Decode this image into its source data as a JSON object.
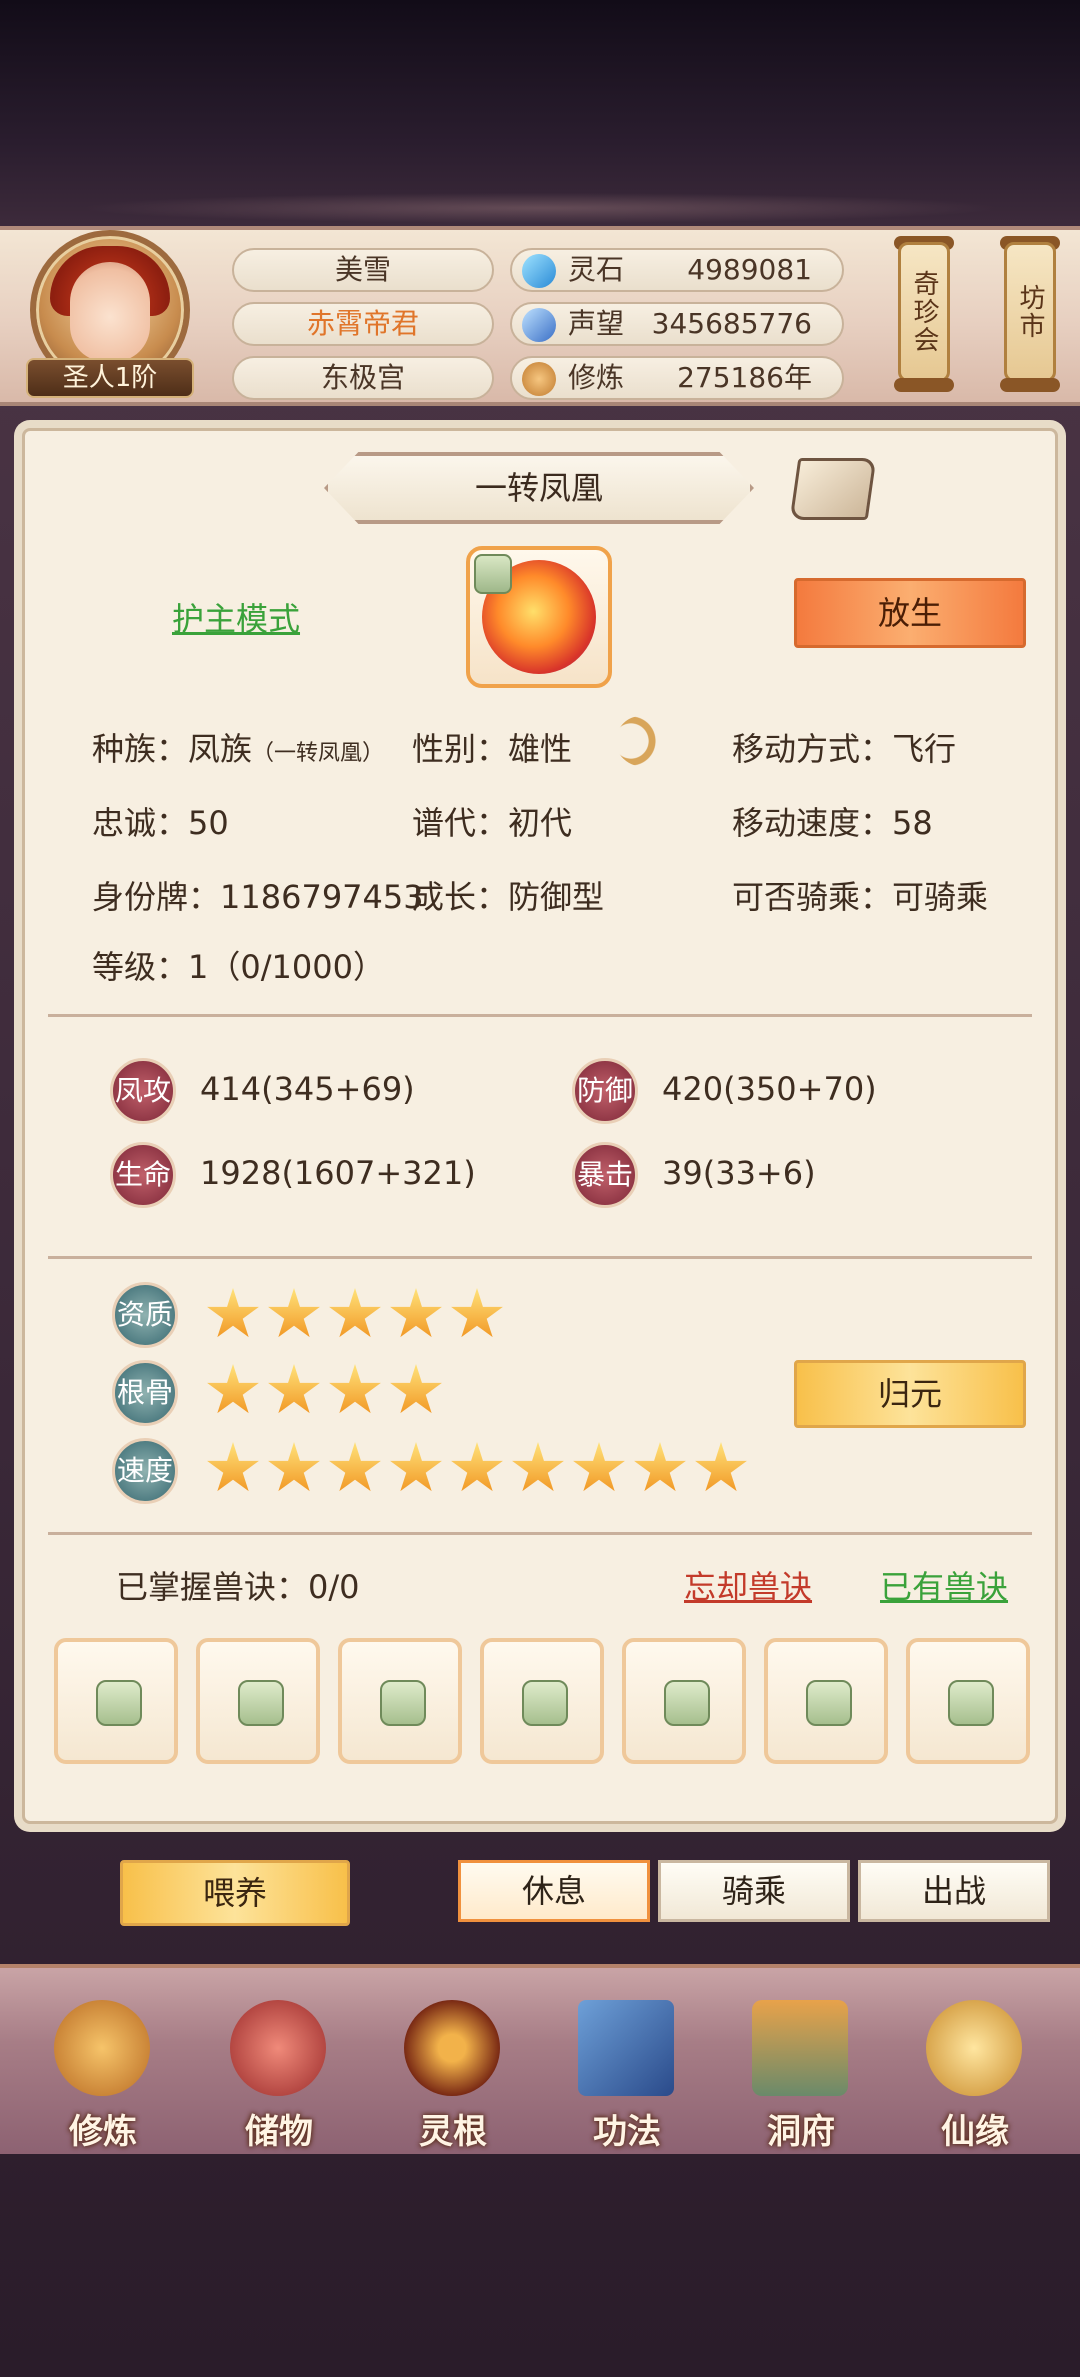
{
  "player": {
    "name": "美雪",
    "title": "赤霄帝君",
    "sect": "东极宫",
    "rank": "圣人1阶"
  },
  "resources": [
    {
      "icon": "spirit-stone-icon",
      "label": "灵石",
      "value": "4989081",
      "color": "#3aa9e0"
    },
    {
      "icon": "reputation-icon",
      "label": "声望",
      "value": "345685776",
      "color": "#4c8fd6"
    },
    {
      "icon": "cultivation-icon",
      "label": "修炼",
      "value": "275186年",
      "color": "#d49a4a"
    }
  ],
  "top_buttons": {
    "treasure": "奇珍会",
    "market": "坊市"
  },
  "pet": {
    "name": "一转凤凰",
    "mode_link": "护主模式",
    "release_button": "放生",
    "race_label": "种族：",
    "race": "凤族",
    "race_sub": "（一转凤凰）",
    "gender_label": "性别：",
    "gender": "雄性",
    "move_label": "移动方式：",
    "move": "飞行",
    "loyalty_label": "忠诚：",
    "loyalty": "50",
    "generation_label": "谱代：",
    "generation": "初代",
    "speed_label": "移动速度：",
    "speed": "58",
    "id_label": "身份牌：",
    "id": "1186797453",
    "growth_label": "成长：",
    "growth": "防御型",
    "ride_label": "可否骑乘：",
    "ride": "可骑乘",
    "level_label": "等级：",
    "level": "1（0/1000）"
  },
  "attributes": {
    "attack": {
      "badge": "凤攻",
      "value": "414(345+69)"
    },
    "defense": {
      "badge": "防御",
      "value": "420(350+70)"
    },
    "life": {
      "badge": "生命",
      "value": "1928(1607+321)"
    },
    "crit": {
      "badge": "暴击",
      "value": "39(33+6)"
    }
  },
  "traits": {
    "aptitude": {
      "badge": "资质",
      "stars": 5
    },
    "bone": {
      "badge": "根骨",
      "stars": 4
    },
    "speed": {
      "badge": "速度",
      "stars": 9
    },
    "reset_button": "归元"
  },
  "skills": {
    "mastered_label": "已掌握兽诀：",
    "mastered": "0/0",
    "forget_link": "忘却兽诀",
    "owned_link": "已有兽诀",
    "slot_count": 7
  },
  "actions": {
    "feed": "喂养",
    "rest": "休息",
    "ride": "骑乘",
    "battle": "出战"
  },
  "nav": [
    {
      "icon": "meditation-icon",
      "label": "修炼"
    },
    {
      "icon": "pouch-icon",
      "label": "储物"
    },
    {
      "icon": "spirit-root-icon",
      "label": "灵根"
    },
    {
      "icon": "manual-icon",
      "label": "功法"
    },
    {
      "icon": "cave-mansion-icon",
      "label": "洞府"
    },
    {
      "icon": "fortune-icon",
      "label": "仙缘"
    }
  ]
}
